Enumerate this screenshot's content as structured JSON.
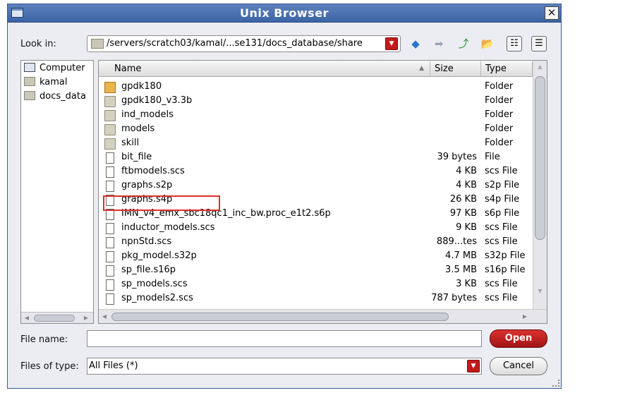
{
  "window": {
    "title": "Unix Browser",
    "close_glyph": "✕"
  },
  "lookin": {
    "label": "Look in:",
    "path": "/servers/scratch03/kamal/...se131/docs_database/share"
  },
  "toolbar": {
    "back_glyph": "◆",
    "forward_glyph": "➡",
    "up_glyph": "⤴",
    "new_folder_glyph": "📂",
    "list_view_glyph": "☷",
    "details_view_glyph": "☰"
  },
  "sidebar": {
    "items": [
      {
        "label": "Computer",
        "icon": "computer-icon"
      },
      {
        "label": "kamal",
        "icon": "home-folder-icon"
      },
      {
        "label": "docs_data",
        "icon": "folder-icon"
      }
    ]
  },
  "files": {
    "columns": [
      "Name",
      "Size",
      "Type"
    ],
    "rows": [
      {
        "name": "gpdk180",
        "size": "",
        "type": "Folder",
        "icon": "folder-open-icon"
      },
      {
        "name": "gpdk180_v3.3b",
        "size": "",
        "type": "Folder",
        "icon": "folder-icon"
      },
      {
        "name": "ind_models",
        "size": "",
        "type": "Folder",
        "icon": "folder-icon"
      },
      {
        "name": "models",
        "size": "",
        "type": "Folder",
        "icon": "folder-icon"
      },
      {
        "name": "skill",
        "size": "",
        "type": "Folder",
        "icon": "folder-icon"
      },
      {
        "name": "bit_file",
        "size": "39 bytes",
        "type": "File",
        "icon": "file-icon"
      },
      {
        "name": "ftbmodels.scs",
        "size": "4 KB",
        "type": "scs File",
        "icon": "file-icon"
      },
      {
        "name": "graphs.s2p",
        "size": "4 KB",
        "type": "s2p File",
        "icon": "file-icon"
      },
      {
        "name": "graphs.s4p",
        "size": "26 KB",
        "type": "s4p File",
        "icon": "file-icon"
      },
      {
        "name": "IMN_v4_emx_sbc18qc1_inc_bw.proc_e1t2.s6p",
        "size": "97 KB",
        "type": "s6p File",
        "icon": "file-icon"
      },
      {
        "name": "inductor_models.scs",
        "size": "9 KB",
        "type": "scs File",
        "icon": "file-icon"
      },
      {
        "name": "npnStd.scs",
        "size": "889...tes",
        "type": "scs File",
        "icon": "file-icon"
      },
      {
        "name": "pkg_model.s32p",
        "size": "4.7 MB",
        "type": "s32p File",
        "icon": "file-icon"
      },
      {
        "name": "sp_file.s16p",
        "size": "3.5 MB",
        "type": "s16p File",
        "icon": "file-icon"
      },
      {
        "name": "sp_models.scs",
        "size": "3 KB",
        "type": "scs File",
        "icon": "file-icon"
      },
      {
        "name": "sp_models2.scs",
        "size": "787 bytes",
        "type": "scs File",
        "icon": "file-icon"
      }
    ]
  },
  "filename": {
    "label": "File name:",
    "value": ""
  },
  "filetype": {
    "label": "Files of type:",
    "value": "All Files (*)"
  },
  "buttons": {
    "open": "Open",
    "cancel": "Cancel"
  }
}
